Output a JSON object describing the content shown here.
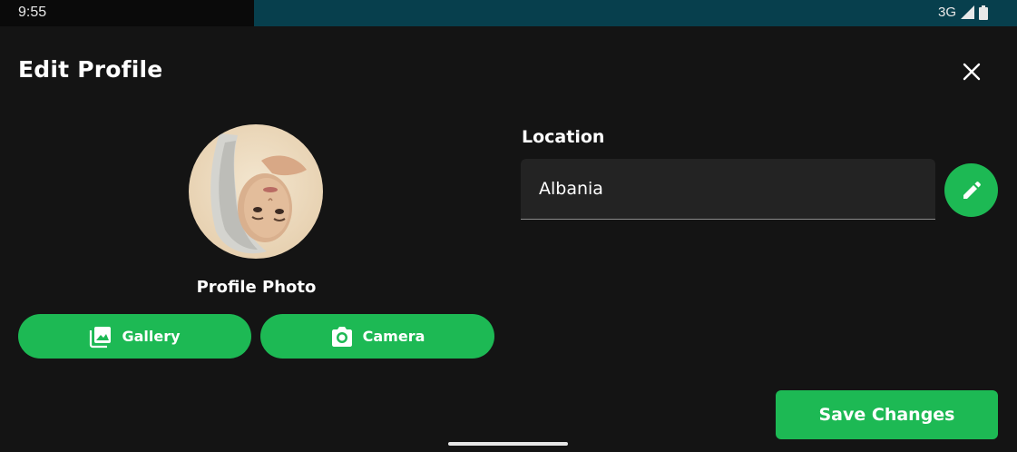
{
  "status_bar": {
    "time": "9:55",
    "network": "3G",
    "signal_icon": "signal-icon",
    "battery_icon": "battery-icon"
  },
  "header": {
    "title": "Edit Profile",
    "close_icon": "close-icon"
  },
  "profile_photo": {
    "label": "Profile Photo",
    "gallery_label": "Gallery",
    "gallery_icon": "image-gallery-icon",
    "camera_label": "Camera",
    "camera_icon": "camera-icon"
  },
  "location": {
    "label": "Location",
    "value": "Albania",
    "edit_icon": "pencil-icon"
  },
  "actions": {
    "save_label": "Save Changes"
  },
  "colors": {
    "accent": "#1db954",
    "background": "#141414",
    "field": "#232323",
    "status_bar_right": "#073f4d"
  }
}
